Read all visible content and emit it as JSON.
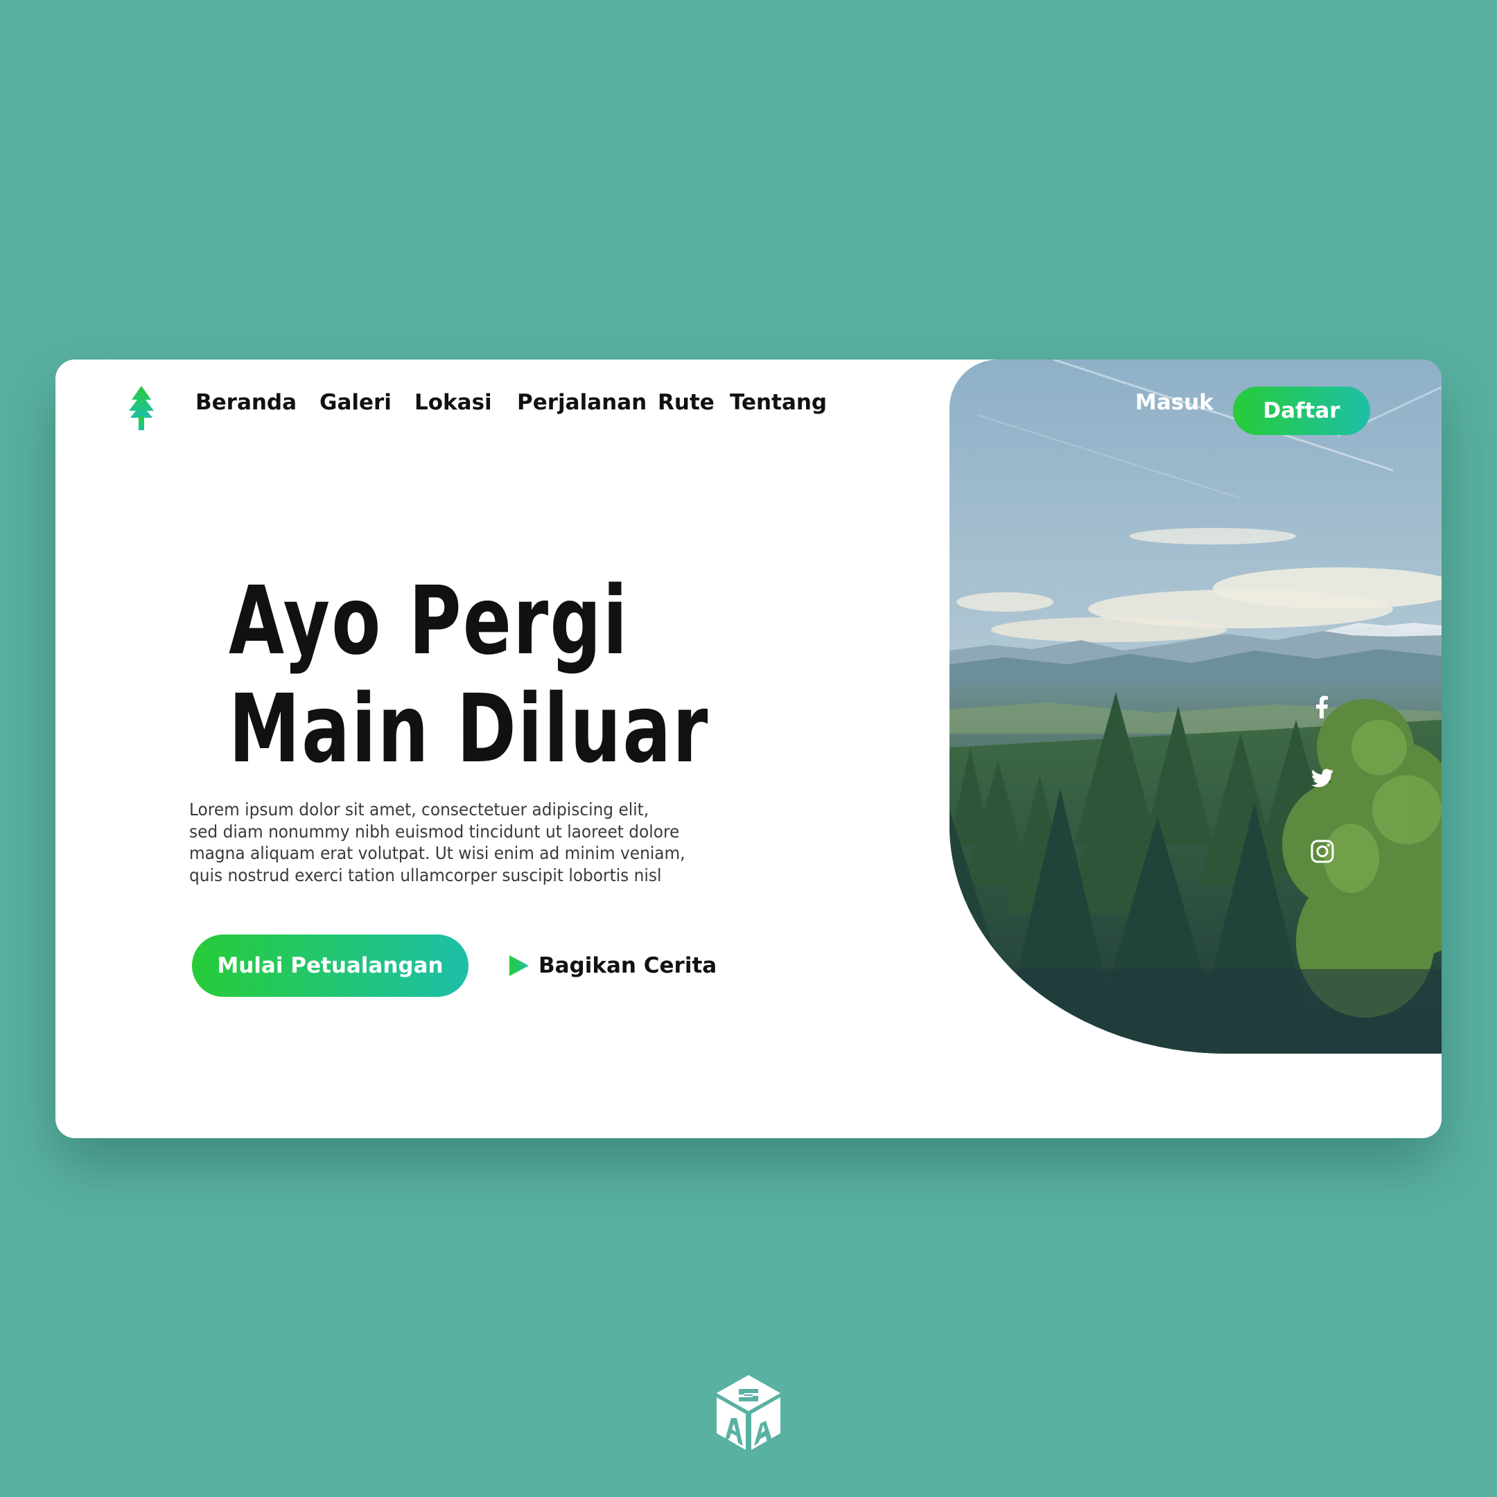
{
  "nav": {
    "items": [
      {
        "label": "Beranda"
      },
      {
        "label": "Galeri"
      },
      {
        "label": "Lokasi"
      },
      {
        "label": "Perjalanan"
      },
      {
        "label": "Rute"
      },
      {
        "label": "Tentang"
      }
    ],
    "login_label": "Masuk",
    "register_label": "Daftar"
  },
  "hero": {
    "headline_line1": "Ayo Pergi",
    "headline_line2": "Main Diluar",
    "body_lines": [
      "Lorem ipsum dolor sit amet, consectetuer adipiscing elit,",
      "sed diam nonummy nibh euismod tincidunt ut laoreet dolore",
      "magna aliquam erat volutpat. Ut wisi enim ad minim veniam,",
      "quis nostrud exerci tation ullamcorper suscipit lobortis nisl"
    ],
    "cta_label": "Mulai Petualangan",
    "share_label": "Bagikan Cerita"
  },
  "social": {
    "icons": [
      "facebook-icon",
      "twitter-icon",
      "instagram-icon"
    ]
  },
  "colors": {
    "background": "#59b1a2",
    "accent_start": "#27cc37",
    "accent_end": "#1ebfa9",
    "text": "#111111"
  }
}
